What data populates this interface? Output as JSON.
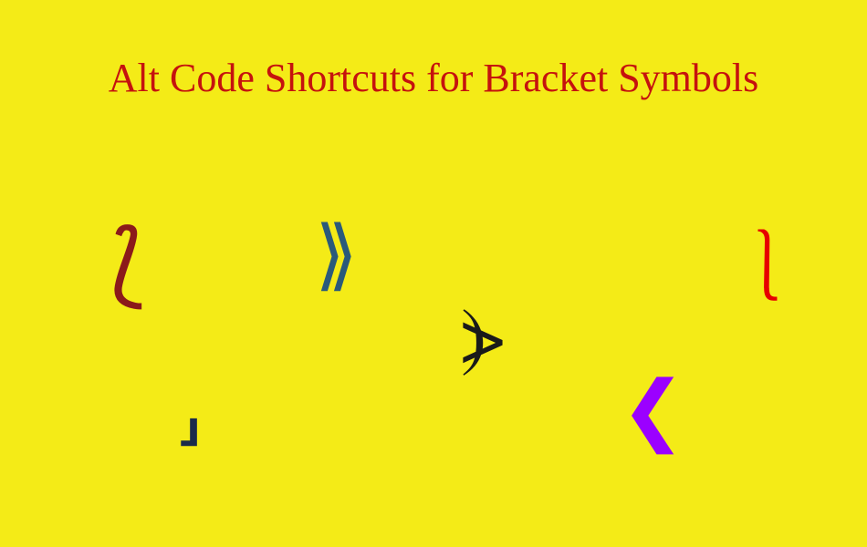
{
  "title": "Alt Code Shortcuts for Bracket Symbols",
  "symbols": {
    "s1": "⟅",
    "s2": "⟫",
    "s3": "⎱",
    "s4": "⦔",
    "s5": "⸥",
    "s6": "❮"
  }
}
